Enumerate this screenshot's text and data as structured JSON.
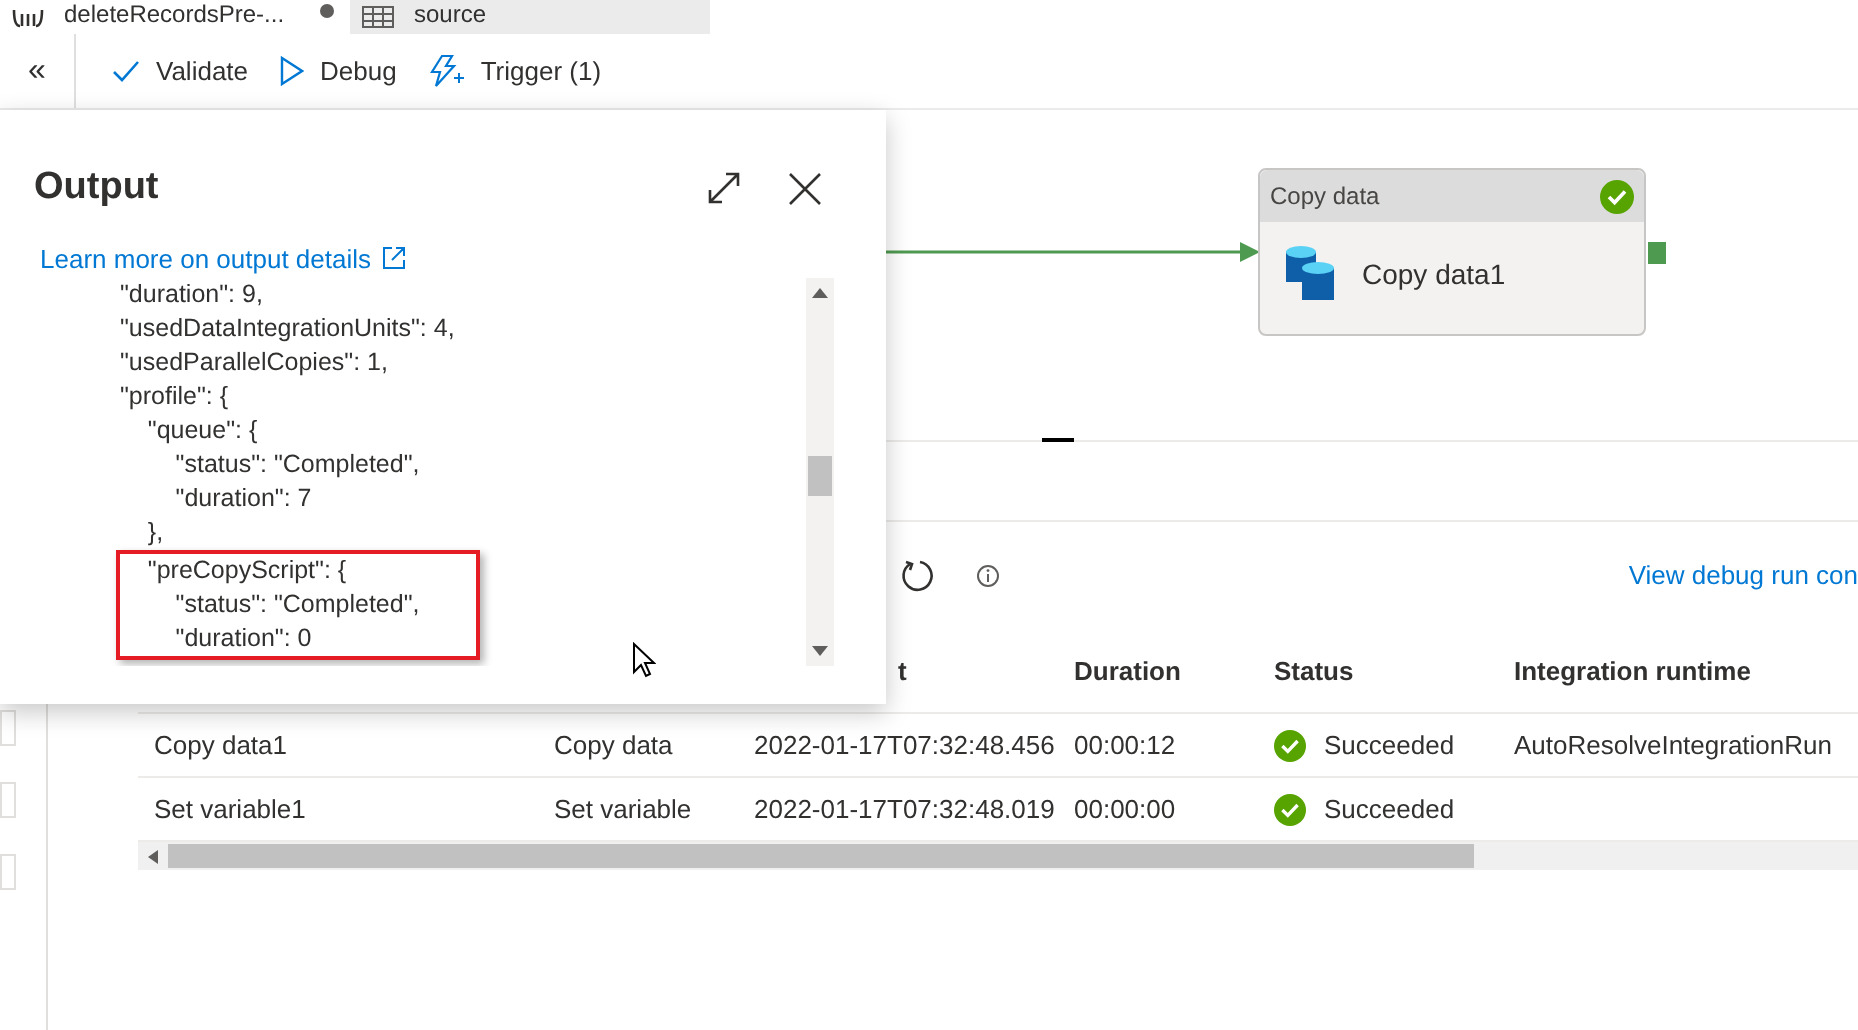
{
  "tabs": [
    {
      "label": "deleteRecordsPre-...",
      "selected": true,
      "unsaved": true,
      "kind": "pipeline"
    },
    {
      "label": "source",
      "selected": false,
      "unsaved": false,
      "kind": "dataset"
    }
  ],
  "toolbar": {
    "collapse": "«",
    "buttons": [
      {
        "label": "Validate",
        "kind": "validate"
      },
      {
        "label": "Debug",
        "kind": "debug"
      },
      {
        "label": "Trigger (1)",
        "kind": "trigger"
      }
    ]
  },
  "canvas": {
    "node": {
      "type": "Copy data",
      "name": "Copy data1",
      "succeeded": true
    }
  },
  "output": {
    "title": "Output",
    "link": "Learn more on output details",
    "lines": [
      {
        "text": "\"duration\": 9,",
        "highlighted": false
      },
      {
        "text": "\"usedDataIntegrationUnits\": 4,",
        "highlighted": false
      },
      {
        "text": "\"usedParallelCopies\": 1,",
        "highlighted": false
      },
      {
        "text": "\"profile\": {",
        "highlighted": false
      },
      {
        "text": "    \"queue\": {",
        "highlighted": false
      },
      {
        "text": "        \"status\": \"Completed\",",
        "highlighted": false
      },
      {
        "text": "        \"duration\": 7",
        "highlighted": false
      },
      {
        "text": "    },",
        "highlighted": false
      },
      {
        "text": "    \"preCopyScript\": {",
        "highlighted": true
      },
      {
        "text": "        \"status\": \"Completed\",",
        "highlighted": true
      },
      {
        "text": "        \"duration\": 0",
        "highlighted": true
      }
    ]
  },
  "runs": {
    "link": "View debug run con",
    "columns": [
      "",
      "",
      "t",
      "Duration",
      "Status",
      "Integration runtime"
    ],
    "rows": [
      {
        "cells": [
          "Copy data1",
          "Copy data",
          "2022-01-17T07:32:48.456",
          "00:00:12",
          "Succeeded",
          "AutoResolveIntegrationRun"
        ],
        "succeeded": true
      },
      {
        "cells": [
          "Set variable1",
          "Set variable",
          "2022-01-17T07:32:48.019",
          "00:00:00",
          "Succeeded"
        ],
        "succeeded": true
      }
    ]
  }
}
